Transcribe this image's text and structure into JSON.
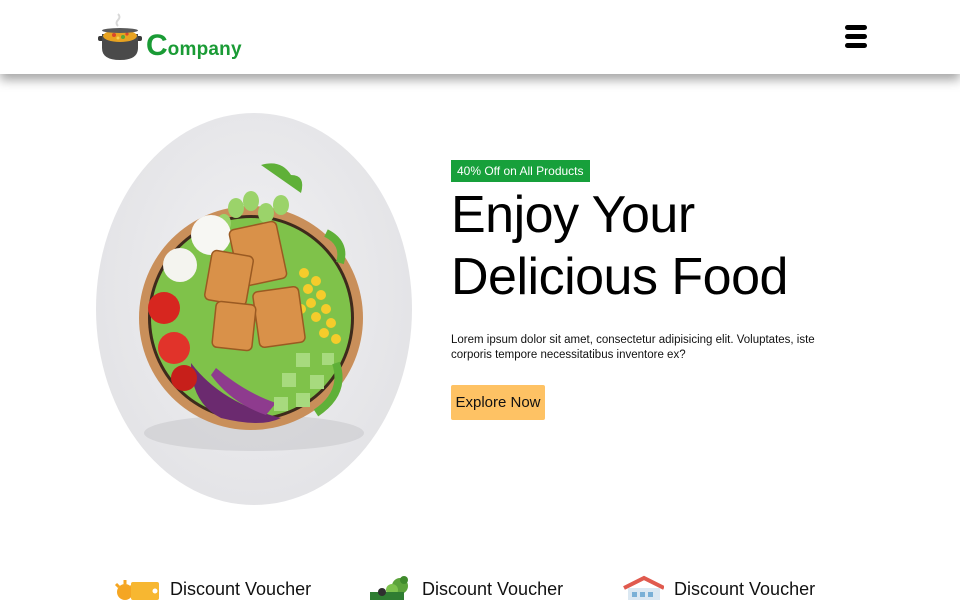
{
  "header": {
    "logo": {
      "first_letter": "C",
      "rest": "ompany"
    },
    "menu_icon": "hamburger-menu-icon"
  },
  "hero": {
    "image": "food-bowl-image",
    "badge": "40% Off on All Products",
    "title_line1": "Enjoy Your",
    "title_line2": "Delicious Food",
    "description": "Lorem ipsum dolor sit amet, consectetur adipisicing elit. Voluptates, iste corporis tempore necessitatibus inventore ex?",
    "cta_label": "Explore Now"
  },
  "vouchers": [
    {
      "icon": "discount-tag-icon",
      "title": "Discount Voucher"
    },
    {
      "icon": "food-basket-icon",
      "title": "Discount Voucher"
    },
    {
      "icon": "store-icon",
      "title": "Discount Voucher"
    }
  ],
  "colors": {
    "brand_green": "#1a9b35",
    "badge_green": "#17a03b",
    "cta_orange": "#fec264"
  }
}
